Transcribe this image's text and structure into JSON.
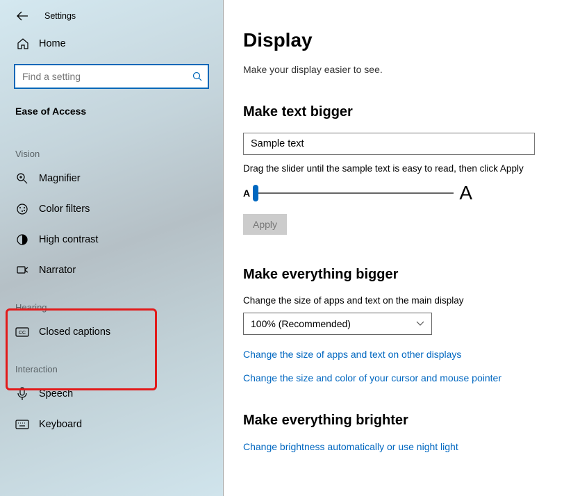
{
  "titlebar": {
    "title": "Settings"
  },
  "home": {
    "label": "Home"
  },
  "search": {
    "placeholder": "Find a setting"
  },
  "category": "Ease of Access",
  "groups": {
    "vision": {
      "label": "Vision",
      "items": [
        {
          "label": "Magnifier"
        },
        {
          "label": "Color filters"
        },
        {
          "label": "High contrast"
        },
        {
          "label": "Narrator"
        }
      ]
    },
    "hearing": {
      "label": "Hearing",
      "items": [
        {
          "label": "Closed captions"
        }
      ]
    },
    "interaction": {
      "label": "Interaction",
      "items": [
        {
          "label": "Speech"
        },
        {
          "label": "Keyboard"
        }
      ]
    }
  },
  "page": {
    "heading": "Display",
    "subtitle": "Make your display easier to see.",
    "text_section": {
      "heading": "Make text bigger",
      "sample": "Sample text",
      "slider_desc": "Drag the slider until the sample text is easy to read, then click Apply",
      "small_a": "A",
      "big_a": "A",
      "apply": "Apply"
    },
    "everything_section": {
      "heading": "Make everything bigger",
      "desc": "Change the size of apps and text on the main display",
      "select_value": "100% (Recommended)",
      "link1": "Change the size of apps and text on other displays",
      "link2": "Change the size and color of your cursor and mouse pointer"
    },
    "brighter_section": {
      "heading": "Make everything brighter",
      "link": "Change brightness automatically or use night light"
    }
  }
}
